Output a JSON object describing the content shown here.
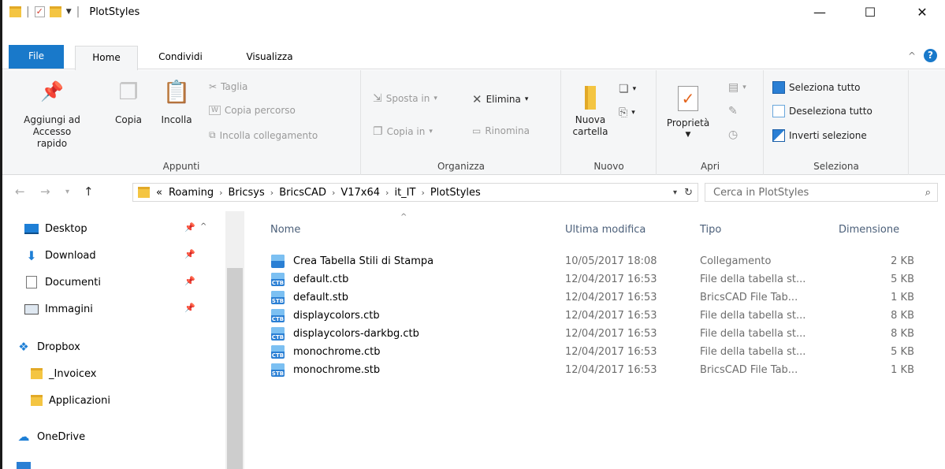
{
  "window": {
    "title": "PlotStyles",
    "minimize": "—",
    "maximize": "☐",
    "close": "✕"
  },
  "tabs": {
    "file": "File",
    "home": "Home",
    "share": "Condividi",
    "view": "Visualizza"
  },
  "ribbon": {
    "appunti": {
      "label": "Appunti",
      "pin": "Aggiungi ad\nAccesso rapido",
      "pin1": "Aggiungi ad",
      "pin2": "Accesso rapido",
      "copy": "Copia",
      "paste": "Incolla",
      "cut": "Taglia",
      "copy_path": "Copia percorso",
      "paste_link": "Incolla collegamento"
    },
    "organizza": {
      "label": "Organizza",
      "move_to": "Sposta in",
      "copy_to": "Copia in",
      "delete": "Elimina",
      "rename": "Rinomina"
    },
    "nuovo": {
      "label": "Nuovo",
      "new_folder1": "Nuova",
      "new_folder2": "cartella"
    },
    "apri": {
      "label": "Apri",
      "properties": "Proprietà"
    },
    "seleziona": {
      "label": "Seleziona",
      "select_all": "Seleziona tutto",
      "deselect_all": "Deseleziona tutto",
      "invert": "Inverti selezione"
    }
  },
  "address": {
    "crumbs": [
      "«",
      "Roaming",
      "Bricsys",
      "BricsCAD",
      "V17x64",
      "it_IT",
      "PlotStyles"
    ],
    "search_placeholder": "Cerca in PlotStyles"
  },
  "sidebar": {
    "items": [
      {
        "label": "Desktop",
        "icon": "desktop-icon",
        "pinned": true
      },
      {
        "label": "Download",
        "icon": "download-icon",
        "pinned": true
      },
      {
        "label": "Documenti",
        "icon": "documents-icon",
        "pinned": true
      },
      {
        "label": "Immagini",
        "icon": "pictures-icon",
        "pinned": true
      },
      {
        "label": "Dropbox",
        "icon": "dropbox-icon"
      },
      {
        "label": "_Invoicex",
        "icon": "folder-icon"
      },
      {
        "label": "Applicazioni",
        "icon": "folder-icon"
      },
      {
        "label": "OneDrive",
        "icon": "onedrive-icon"
      }
    ]
  },
  "columns": {
    "name": "Nome",
    "modified": "Ultima modifica",
    "type": "Tipo",
    "size": "Dimensione"
  },
  "files": [
    {
      "name": "Crea Tabella Stili di Stampa",
      "modified": "10/05/2017 18:08",
      "type": "Collegamento",
      "size": "2 KB",
      "badge": ""
    },
    {
      "name": "default.ctb",
      "modified": "12/04/2017 16:53",
      "type": "File della tabella st...",
      "size": "5 KB",
      "badge": "CTB"
    },
    {
      "name": "default.stb",
      "modified": "12/04/2017 16:53",
      "type": "BricsCAD File Tab...",
      "size": "1 KB",
      "badge": "STB"
    },
    {
      "name": "displaycolors.ctb",
      "modified": "12/04/2017 16:53",
      "type": "File della tabella st...",
      "size": "8 KB",
      "badge": "CTB"
    },
    {
      "name": "displaycolors-darkbg.ctb",
      "modified": "12/04/2017 16:53",
      "type": "File della tabella st...",
      "size": "8 KB",
      "badge": "CTB"
    },
    {
      "name": "monochrome.ctb",
      "modified": "12/04/2017 16:53",
      "type": "File della tabella st...",
      "size": "5 KB",
      "badge": "CTB"
    },
    {
      "name": "monochrome.stb",
      "modified": "12/04/2017 16:53",
      "type": "BricsCAD File Tab...",
      "size": "1 KB",
      "badge": "STB"
    }
  ],
  "colors": {
    "accent": "#1979ca",
    "ribbon_bg": "#f5f6f7"
  }
}
